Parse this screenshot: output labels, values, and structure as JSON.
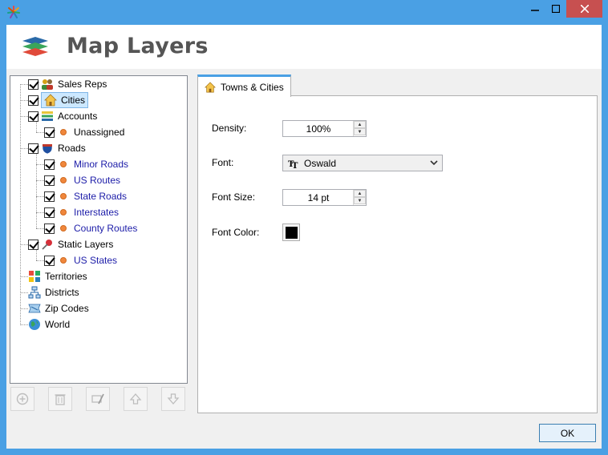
{
  "window": {
    "title": ""
  },
  "header": {
    "title": "Map Layers"
  },
  "tree": [
    {
      "label": "Sales Reps",
      "checked": true,
      "icon": "people-icon",
      "color": "black"
    },
    {
      "label": "Cities",
      "checked": true,
      "icon": "house-icon",
      "color": "black",
      "selected": true
    },
    {
      "label": "Accounts",
      "checked": true,
      "icon": "stack-icon",
      "color": "black"
    },
    {
      "label": "Unassigned",
      "checked": true,
      "icon": "dot-icon",
      "color": "black"
    },
    {
      "label": "Roads",
      "checked": true,
      "icon": "highway-shield-icon",
      "color": "black"
    },
    {
      "label": "Minor Roads",
      "checked": true,
      "icon": "dot-icon",
      "color": "blue"
    },
    {
      "label": "US Routes",
      "checked": true,
      "icon": "dot-icon",
      "color": "blue"
    },
    {
      "label": "State Roads",
      "checked": true,
      "icon": "dot-icon",
      "color": "blue"
    },
    {
      "label": "Interstates",
      "checked": true,
      "icon": "dot-icon",
      "color": "blue"
    },
    {
      "label": "County Routes",
      "checked": true,
      "icon": "dot-icon",
      "color": "blue"
    },
    {
      "label": "Static Layers",
      "checked": true,
      "icon": "pushpin-icon",
      "color": "black"
    },
    {
      "label": "US States",
      "checked": true,
      "icon": "dot-icon",
      "color": "blue"
    },
    {
      "label": "Territories",
      "checked": false,
      "icon": "territories-icon",
      "color": "black"
    },
    {
      "label": "Districts",
      "checked": false,
      "icon": "districts-icon",
      "color": "black"
    },
    {
      "label": "Zip Codes",
      "checked": false,
      "icon": "zip-codes-icon",
      "color": "black"
    },
    {
      "label": "World",
      "checked": false,
      "icon": "globe-icon",
      "color": "black"
    }
  ],
  "toolbar": [
    "add-icon",
    "trash-icon",
    "edit-icon",
    "move-up-icon",
    "move-down-icon"
  ],
  "tab": {
    "label": "Towns & Cities"
  },
  "form": {
    "density_label": "Density:",
    "density_value": "100%",
    "font_label": "Font:",
    "font_value": "Oswald",
    "font_size_label": "Font Size:",
    "font_size_value": "14 pt",
    "font_color_label": "Font Color:",
    "font_color": "#000000"
  },
  "ok_label": "OK",
  "colors": {
    "accent": "#4aa0e4",
    "close": "#c75050",
    "link_blue": "#1c1ca8",
    "bullet": "#f0873c"
  }
}
